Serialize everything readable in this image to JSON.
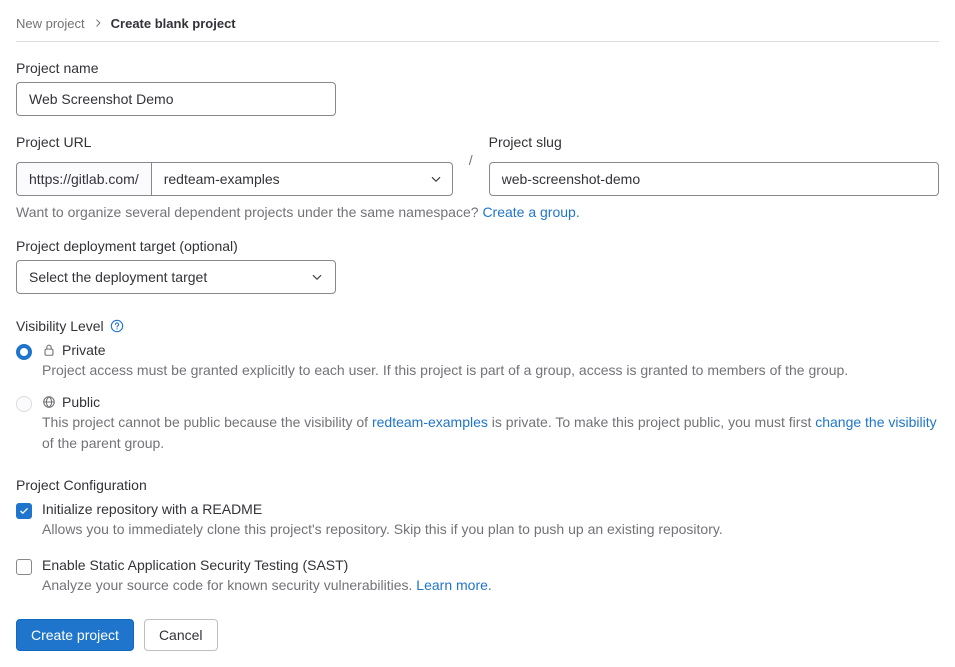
{
  "breadcrumb": {
    "parent": "New project",
    "current": "Create blank project"
  },
  "project_name": {
    "label": "Project name",
    "value": "Web Screenshot Demo"
  },
  "project_url": {
    "label": "Project URL",
    "base": "https://gitlab.com/",
    "namespace": "redteam-examples"
  },
  "project_slug": {
    "label": "Project slug",
    "value": "web-screenshot-demo"
  },
  "namespace_hint": {
    "text": "Want to organize several dependent projects under the same namespace? ",
    "link": "Create a group."
  },
  "deployment": {
    "label": "Project deployment target (optional)",
    "placeholder": "Select the deployment target"
  },
  "visibility": {
    "heading": "Visibility Level",
    "private": {
      "label": "Private",
      "desc": "Project access must be granted explicitly to each user. If this project is part of a group, access is granted to members of the group."
    },
    "public": {
      "label": "Public",
      "desc_prefix": "This project cannot be public because the visibility of ",
      "group_link": "redteam-examples",
      "desc_mid": " is private. To make this project public, you must first ",
      "change_link": "change the visibility",
      "desc_suffix": " of the parent group."
    }
  },
  "config": {
    "heading": "Project Configuration",
    "readme": {
      "label": "Initialize repository with a README",
      "desc": "Allows you to immediately clone this project's repository. Skip this if you plan to push up an existing repository."
    },
    "sast": {
      "label": "Enable Static Application Security Testing (SAST)",
      "desc_prefix": "Analyze your source code for known security vulnerabilities. ",
      "link": "Learn more."
    }
  },
  "buttons": {
    "create": "Create project",
    "cancel": "Cancel"
  }
}
